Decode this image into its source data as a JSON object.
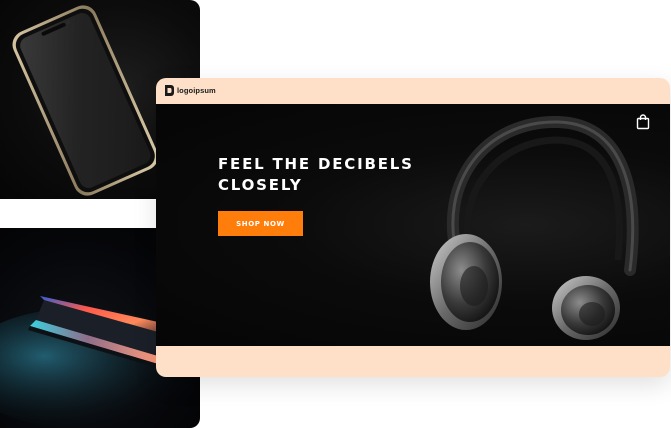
{
  "brand": {
    "logo_text": "logoipsum"
  },
  "hero": {
    "headline_line1": "FEEL THE DECIBELS",
    "headline_line2": "CLOSELY",
    "cta_label": "SHOP NOW"
  },
  "colors": {
    "accent": "#ff7d0a",
    "browser_frame": "#fde0c7",
    "hero_background": "#0a0a0a"
  },
  "icons": {
    "cart": "shopping-bag-icon"
  },
  "images": {
    "phone": "smartphone-photo",
    "laptop": "laptop-photo",
    "product": "headphones-photo"
  }
}
